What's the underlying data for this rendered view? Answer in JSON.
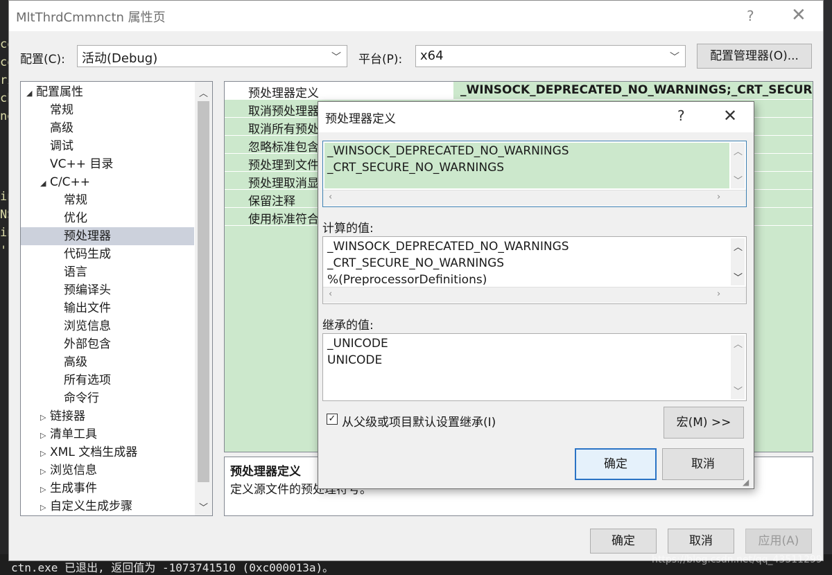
{
  "ide": {
    "left_code_lines": [
      "co",
      "co",
      "ri",
      "ch",
      "ne",
      "in",
      "NS",
      "in",
      "'s"
    ],
    "bottom_text": "ctn.exe 已退出, 返回值为 -1073741510 (0xc000013a)。",
    "watermark": "https://blog.csdn.net/qq_43511299"
  },
  "dialog": {
    "title": "MltThrdCmmnctn 属性页",
    "help_glyph": "?",
    "close_glyph": "✕",
    "config_label": "配置(C):",
    "config_value": "活动(Debug)",
    "platform_label": "平台(P):",
    "platform_value": "x64",
    "config_manager_button": "配置管理器(O)...",
    "ok_button": "确定",
    "cancel_button": "取消",
    "apply_button": "应用(A)"
  },
  "tree": {
    "items": [
      {
        "label": "配置属性",
        "level": 0,
        "expander": "◢",
        "selected": false
      },
      {
        "label": "常规",
        "level": 1,
        "expander": "",
        "selected": false
      },
      {
        "label": "高级",
        "level": 1,
        "expander": "",
        "selected": false
      },
      {
        "label": "调试",
        "level": 1,
        "expander": "",
        "selected": false
      },
      {
        "label": "VC++ 目录",
        "level": 1,
        "expander": "",
        "selected": false
      },
      {
        "label": "C/C++",
        "level": 1,
        "expander": "◢",
        "selected": false
      },
      {
        "label": "常规",
        "level": 2,
        "expander": "",
        "selected": false
      },
      {
        "label": "优化",
        "level": 2,
        "expander": "",
        "selected": false
      },
      {
        "label": "预处理器",
        "level": 2,
        "expander": "",
        "selected": true
      },
      {
        "label": "代码生成",
        "level": 2,
        "expander": "",
        "selected": false
      },
      {
        "label": "语言",
        "level": 2,
        "expander": "",
        "selected": false
      },
      {
        "label": "预编译头",
        "level": 2,
        "expander": "",
        "selected": false
      },
      {
        "label": "输出文件",
        "level": 2,
        "expander": "",
        "selected": false
      },
      {
        "label": "浏览信息",
        "level": 2,
        "expander": "",
        "selected": false
      },
      {
        "label": "外部包含",
        "level": 2,
        "expander": "",
        "selected": false
      },
      {
        "label": "高级",
        "level": 2,
        "expander": "",
        "selected": false
      },
      {
        "label": "所有选项",
        "level": 2,
        "expander": "",
        "selected": false
      },
      {
        "label": "命令行",
        "level": 2,
        "expander": "",
        "selected": false
      },
      {
        "label": "链接器",
        "level": 1,
        "expander": "▷",
        "selected": false
      },
      {
        "label": "清单工具",
        "level": 1,
        "expander": "▷",
        "selected": false
      },
      {
        "label": "XML 文档生成器",
        "level": 1,
        "expander": "▷",
        "selected": false
      },
      {
        "label": "浏览信息",
        "level": 1,
        "expander": "▷",
        "selected": false
      },
      {
        "label": "生成事件",
        "level": 1,
        "expander": "▷",
        "selected": false
      },
      {
        "label": "自定义生成步骤",
        "level": 1,
        "expander": "▷",
        "selected": false
      }
    ]
  },
  "grid": {
    "rows": [
      {
        "name": "预处理器定义",
        "value": "_WINSOCK_DEPRECATED_NO_WARNINGS;_CRT_SECURE_"
      },
      {
        "name": "取消预处理器",
        "value": ""
      },
      {
        "name": "取消所有预处",
        "value": ""
      },
      {
        "name": "忽略标准包含",
        "value": ""
      },
      {
        "name": "预处理到文件",
        "value": ""
      },
      {
        "name": "预处理取消显",
        "value": ""
      },
      {
        "name": "保留注释",
        "value": ""
      },
      {
        "name": "使用标准符合",
        "value": ""
      }
    ],
    "description_title": "预处理器定义",
    "description_text": "定义源文件的预处理符号。"
  },
  "subdialog": {
    "title": "预处理器定义",
    "help_glyph": "?",
    "close_glyph": "✕",
    "edit_lines": [
      "_WINSOCK_DEPRECATED_NO_WARNINGS",
      "_CRT_SECURE_NO_WARNINGS"
    ],
    "evaluated_label": "计算的值:",
    "evaluated_lines": [
      "_WINSOCK_DEPRECATED_NO_WARNINGS",
      "_CRT_SECURE_NO_WARNINGS",
      "%(PreprocessorDefinitions)"
    ],
    "inherited_label": "继承的值:",
    "inherited_lines": [
      "_UNICODE",
      "UNICODE"
    ],
    "inherit_checkbox_label": "从父级或项目默认设置继承(I)",
    "inherit_checked": true,
    "macros_button": "宏(M) >>",
    "ok_button": "确定",
    "cancel_button": "取消"
  },
  "colors": {
    "grid_bg": "#cce8cc",
    "selection": "#ccd1dc",
    "primary_border": "#2a73c5"
  }
}
